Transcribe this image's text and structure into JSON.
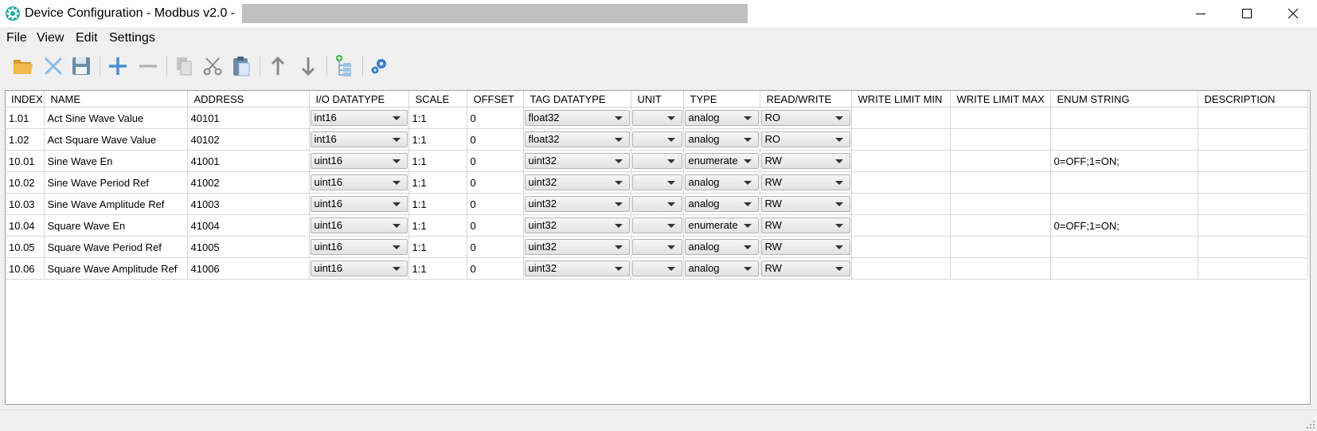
{
  "window": {
    "title": "Device Configuration - Modbus v2.0 -",
    "icons": {
      "app": "gear-icon",
      "minimize": "minimize-icon",
      "maximize": "maximize-icon",
      "close": "close-icon"
    }
  },
  "menu": {
    "items": [
      {
        "label": "File"
      },
      {
        "label": "View"
      },
      {
        "label": "Edit"
      },
      {
        "label": "Settings"
      }
    ]
  },
  "toolbar": {
    "buttons": [
      {
        "name": "open-button",
        "icon": "folder-open-icon"
      },
      {
        "name": "close-file-button",
        "icon": "x-icon"
      },
      {
        "name": "save-button",
        "icon": "floppy-disk-icon"
      },
      {
        "name": "add-row-button",
        "icon": "plus-icon"
      },
      {
        "name": "remove-row-button",
        "icon": "minus-icon"
      },
      {
        "name": "copy-button",
        "icon": "copy-icon"
      },
      {
        "name": "cut-button",
        "icon": "scissors-icon"
      },
      {
        "name": "paste-button",
        "icon": "clipboard-icon"
      },
      {
        "name": "move-up-button",
        "icon": "arrow-up-icon"
      },
      {
        "name": "move-down-button",
        "icon": "arrow-down-icon"
      },
      {
        "name": "add-child-button",
        "icon": "tree-add-icon"
      },
      {
        "name": "settings-button",
        "icon": "gears-icon"
      }
    ]
  },
  "table": {
    "columns": [
      "INDEX",
      "NAME",
      "ADDRESS",
      "I/O DATATYPE",
      "SCALE",
      "OFFSET",
      "TAG DATATYPE",
      "UNIT",
      "TYPE",
      "READ/WRITE",
      "WRITE LIMIT MIN",
      "WRITE LIMIT MAX",
      "ENUM STRING",
      "DESCRIPTION"
    ],
    "rows": [
      {
        "index": "1.01",
        "name": "Act Sine Wave Value",
        "address": "40101",
        "io_datatype": "int16",
        "scale": "1:1",
        "offset": "0",
        "tag_datatype": "float32",
        "unit": "",
        "type": "analog",
        "read_write": "RO",
        "write_limit_min": "",
        "write_limit_max": "",
        "enum_string": "",
        "description": ""
      },
      {
        "index": "1.02",
        "name": "Act Square Wave Value",
        "address": "40102",
        "io_datatype": "int16",
        "scale": "1:1",
        "offset": "0",
        "tag_datatype": "float32",
        "unit": "",
        "type": "analog",
        "read_write": "RO",
        "write_limit_min": "",
        "write_limit_max": "",
        "enum_string": "",
        "description": ""
      },
      {
        "index": "10.01",
        "name": "Sine Wave En",
        "address": "41001",
        "io_datatype": "uint16",
        "scale": "1:1",
        "offset": "0",
        "tag_datatype": "uint32",
        "unit": "",
        "type": "enumerate",
        "read_write": "RW",
        "write_limit_min": "",
        "write_limit_max": "",
        "enum_string": "0=OFF;1=ON;",
        "description": ""
      },
      {
        "index": "10.02",
        "name": "Sine Wave Period Ref",
        "address": "41002",
        "io_datatype": "uint16",
        "scale": "1:1",
        "offset": "0",
        "tag_datatype": "uint32",
        "unit": "",
        "type": "analog",
        "read_write": "RW",
        "write_limit_min": "",
        "write_limit_max": "",
        "enum_string": "",
        "description": ""
      },
      {
        "index": "10.03",
        "name": "Sine Wave Amplitude Ref",
        "address": "41003",
        "io_datatype": "uint16",
        "scale": "1:1",
        "offset": "0",
        "tag_datatype": "uint32",
        "unit": "",
        "type": "analog",
        "read_write": "RW",
        "write_limit_min": "",
        "write_limit_max": "",
        "enum_string": "",
        "description": ""
      },
      {
        "index": "10.04",
        "name": "Square Wave En",
        "address": "41004",
        "io_datatype": "uint16",
        "scale": "1:1",
        "offset": "0",
        "tag_datatype": "uint32",
        "unit": "",
        "type": "enumerate",
        "read_write": "RW",
        "write_limit_min": "",
        "write_limit_max": "",
        "enum_string": "0=OFF;1=ON;",
        "description": ""
      },
      {
        "index": "10.05",
        "name": "Square Wave Period Ref",
        "address": "41005",
        "io_datatype": "uint16",
        "scale": "1:1",
        "offset": "0",
        "tag_datatype": "uint32",
        "unit": "",
        "type": "analog",
        "read_write": "RW",
        "write_limit_min": "",
        "write_limit_max": "",
        "enum_string": "",
        "description": ""
      },
      {
        "index": "10.06",
        "name": "Square Wave Amplitude Ref",
        "address": "41006",
        "io_datatype": "uint16",
        "scale": "1:1",
        "offset": "0",
        "tag_datatype": "uint32",
        "unit": "",
        "type": "analog",
        "read_write": "RW",
        "write_limit_min": "",
        "write_limit_max": "",
        "enum_string": "",
        "description": ""
      }
    ]
  }
}
